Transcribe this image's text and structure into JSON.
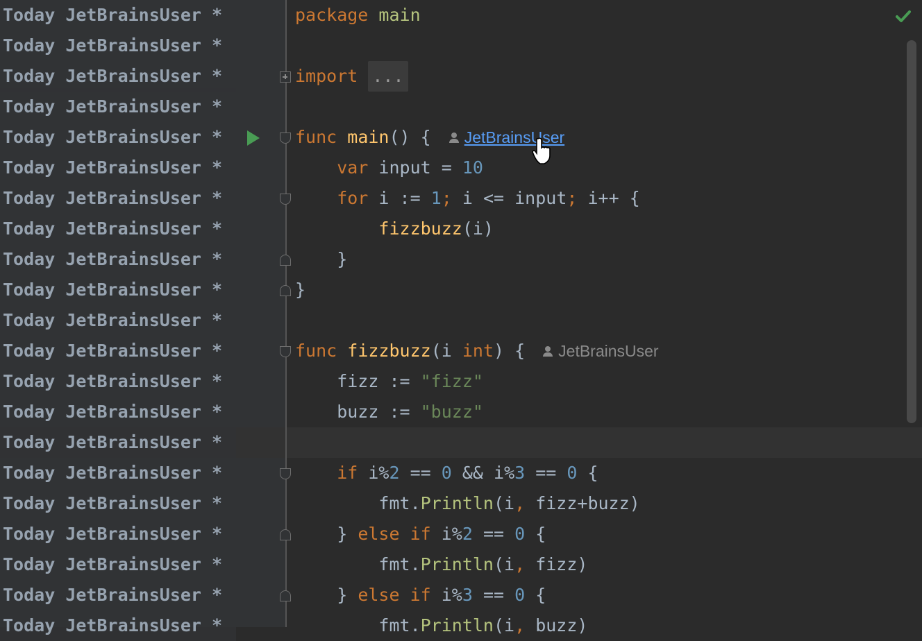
{
  "annotation": {
    "date": "Today",
    "author": "JetBrainsUser",
    "marker": "*"
  },
  "code_lines": [
    {
      "tokens": [
        {
          "t": "package ",
          "c": "kw"
        },
        {
          "t": "main",
          "c": "pkg"
        }
      ]
    },
    {
      "tokens": []
    },
    {
      "tokens": [
        {
          "t": "import ",
          "c": "kw"
        },
        {
          "t": "...",
          "c": "collapsed"
        }
      ]
    },
    {
      "tokens": []
    },
    {
      "tokens": [
        {
          "t": "func ",
          "c": "kw"
        },
        {
          "t": "main",
          "c": "fn"
        },
        {
          "t": "() {",
          "c": "pl"
        }
      ],
      "inlay": {
        "text": "JetBrainsUser",
        "link": true
      }
    },
    {
      "tokens": [
        {
          "t": "    var ",
          "c": "kw"
        },
        {
          "t": "input = ",
          "c": "pl"
        },
        {
          "t": "10",
          "c": "num"
        }
      ]
    },
    {
      "tokens": [
        {
          "t": "    for ",
          "c": "kw"
        },
        {
          "t": "i := ",
          "c": "pl"
        },
        {
          "t": "1",
          "c": "num"
        },
        {
          "t": "; ",
          "c": "kw"
        },
        {
          "t": "i <= input",
          "c": "pl"
        },
        {
          "t": "; ",
          "c": "kw"
        },
        {
          "t": "i++ {",
          "c": "pl"
        }
      ]
    },
    {
      "tokens": [
        {
          "t": "        ",
          "c": "pl"
        },
        {
          "t": "fizzbuzz",
          "c": "fn"
        },
        {
          "t": "(i)",
          "c": "pl"
        }
      ]
    },
    {
      "tokens": [
        {
          "t": "    }",
          "c": "pl"
        }
      ]
    },
    {
      "tokens": [
        {
          "t": "}",
          "c": "pl"
        }
      ]
    },
    {
      "tokens": []
    },
    {
      "tokens": [
        {
          "t": "func ",
          "c": "kw"
        },
        {
          "t": "fizzbuzz",
          "c": "fn"
        },
        {
          "t": "(i ",
          "c": "pl"
        },
        {
          "t": "int",
          "c": "kw"
        },
        {
          "t": ") {",
          "c": "pl"
        }
      ],
      "inlay": {
        "text": "JetBrainsUser",
        "link": false
      }
    },
    {
      "tokens": [
        {
          "t": "    fizz := ",
          "c": "pl"
        },
        {
          "t": "\"fizz\"",
          "c": "str"
        }
      ]
    },
    {
      "tokens": [
        {
          "t": "    buzz := ",
          "c": "pl"
        },
        {
          "t": "\"buzz\"",
          "c": "str"
        }
      ]
    },
    {
      "tokens": []
    },
    {
      "tokens": [
        {
          "t": "    if ",
          "c": "kw"
        },
        {
          "t": "i%",
          "c": "pl"
        },
        {
          "t": "2",
          "c": "num"
        },
        {
          "t": " == ",
          "c": "pl"
        },
        {
          "t": "0",
          "c": "num"
        },
        {
          "t": " && i%",
          "c": "pl"
        },
        {
          "t": "3",
          "c": "num"
        },
        {
          "t": " == ",
          "c": "pl"
        },
        {
          "t": "0",
          "c": "num"
        },
        {
          "t": " {",
          "c": "pl"
        }
      ]
    },
    {
      "tokens": [
        {
          "t": "        fmt.",
          "c": "pl"
        },
        {
          "t": "Println",
          "c": "meth"
        },
        {
          "t": "(i",
          "c": "pl"
        },
        {
          "t": ", ",
          "c": "kw"
        },
        {
          "t": "fizz+buzz)",
          "c": "pl"
        }
      ]
    },
    {
      "tokens": [
        {
          "t": "    } ",
          "c": "pl"
        },
        {
          "t": "else if ",
          "c": "kw"
        },
        {
          "t": "i%",
          "c": "pl"
        },
        {
          "t": "2",
          "c": "num"
        },
        {
          "t": " == ",
          "c": "pl"
        },
        {
          "t": "0",
          "c": "num"
        },
        {
          "t": " {",
          "c": "pl"
        }
      ]
    },
    {
      "tokens": [
        {
          "t": "        fmt.",
          "c": "pl"
        },
        {
          "t": "Println",
          "c": "meth"
        },
        {
          "t": "(i",
          "c": "pl"
        },
        {
          "t": ", ",
          "c": "kw"
        },
        {
          "t": "fizz)",
          "c": "pl"
        }
      ]
    },
    {
      "tokens": [
        {
          "t": "    } ",
          "c": "pl"
        },
        {
          "t": "else if ",
          "c": "kw"
        },
        {
          "t": "i%",
          "c": "pl"
        },
        {
          "t": "3",
          "c": "num"
        },
        {
          "t": " == ",
          "c": "pl"
        },
        {
          "t": "0",
          "c": "num"
        },
        {
          "t": " {",
          "c": "pl"
        }
      ]
    },
    {
      "tokens": [
        {
          "t": "        fmt.",
          "c": "pl"
        },
        {
          "t": "Println",
          "c": "meth"
        },
        {
          "t": "(i",
          "c": "pl"
        },
        {
          "t": ", ",
          "c": "kw"
        },
        {
          "t": "buzz)",
          "c": "pl"
        }
      ]
    }
  ],
  "icons": {
    "run": "run-icon",
    "inspection_ok": "checkmark-icon",
    "author": "person-icon",
    "pointer": "hand-cursor-icon"
  },
  "colors": {
    "background": "#2b2b2b",
    "gutter": "#313335",
    "keyword": "#cc7832",
    "function": "#ffc66d",
    "number": "#6897bb",
    "string": "#6a8759",
    "link": "#589df6",
    "run_green": "#499c54"
  }
}
